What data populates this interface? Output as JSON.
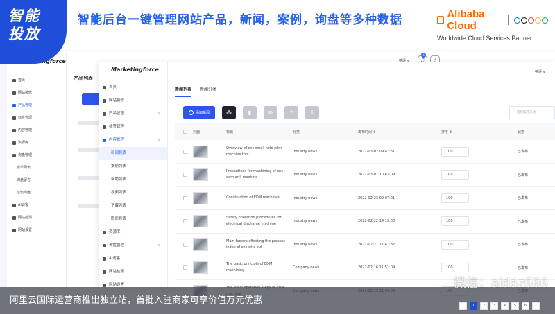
{
  "banner": {
    "badge_line1": "智能",
    "badge_line2": "投放",
    "headline": "智能后台一键管理网站产品，新闻，案例，询盘等多种数据",
    "partner_brand": "Alibaba Cloud",
    "partner_sub": "Worldwide Cloud Services Partner"
  },
  "back_app": {
    "logo": "Marketingforce",
    "title": "产品列表",
    "lang": "英语 ∨",
    "notification_count": "4",
    "menu": [
      {
        "label": "首页"
      },
      {
        "label": "网站装修"
      },
      {
        "label": "产品管理"
      },
      {
        "label": "标签管理"
      },
      {
        "label": "内容管理"
      },
      {
        "label": "资源库"
      },
      {
        "label": "询盘管理"
      },
      {
        "label": "表单列表"
      },
      {
        "label": "询盘留言"
      },
      {
        "label": "垃圾询盘"
      },
      {
        "label": "AI访客"
      },
      {
        "label": "网站检测"
      },
      {
        "label": "网站设置"
      }
    ]
  },
  "app": {
    "logo": "Marketingforce",
    "lang": "英语 ∨",
    "menu": [
      {
        "label": "首页"
      },
      {
        "label": "网站装修"
      },
      {
        "label": "产品管理"
      },
      {
        "label": "标签管理"
      },
      {
        "label": "内容管理"
      },
      {
        "label": "新闻列表"
      },
      {
        "label": "案例列表"
      },
      {
        "label": "帮助列表"
      },
      {
        "label": "视频列表"
      },
      {
        "label": "下载列表"
      },
      {
        "label": "图册列表"
      },
      {
        "label": "资源库"
      },
      {
        "label": "询盘管理"
      },
      {
        "label": "AI访客"
      },
      {
        "label": "网站检测"
      },
      {
        "label": "网站设置"
      }
    ],
    "tabs": [
      "新闻列表",
      "新闻分类"
    ],
    "add_button": "添加新闻",
    "filter_placeholder": "选择排序方式",
    "columns": [
      "封面",
      "标题",
      "分类",
      "发布时间 ⇕",
      "排序 ⇕",
      "状态"
    ],
    "rows": [
      {
        "title": "Overview of cnc small hole edm machine tool",
        "category": "Industry news",
        "date": "2022-03-02 09:47:31",
        "sort": "100",
        "status": "已发布"
      },
      {
        "title": "Precautions for machining of cnc edm drill machine",
        "category": "Industry news",
        "date": "2022-03-01 10:43:09",
        "sort": "100",
        "status": "已发布"
      },
      {
        "title": "Construction of EDM machines",
        "category": "Industry news",
        "date": "2022-02-23 09:07:01",
        "sort": "100",
        "status": "已发布"
      },
      {
        "title": "Safety operation procedures for electrical discharge machine",
        "category": "Industry news",
        "date": "2022-02-22 14:13:08",
        "sort": "100",
        "status": "已发布"
      },
      {
        "title": "Main factors affecting the process index of cnc wire cut",
        "category": "Industry news",
        "date": "2022-02-21 17:41:32",
        "sort": "100",
        "status": "已发布"
      },
      {
        "title": "The basic principle of EDM machining",
        "category": "Company news",
        "date": "2022-02-16 11:51:09",
        "sort": "100",
        "status": "已发布"
      },
      {
        "title": "The basic operation steps of EDM machine",
        "category": "Company news",
        "date": "2022-02-15 11:44:03",
        "sort": "100",
        "status": "已发布"
      }
    ],
    "pager": [
      "‹",
      "1",
      "2",
      "3",
      "4",
      "5",
      "6",
      "…"
    ]
  },
  "caption": "阿里云国际运营商推出独立站，首批入驻商家可享价值万元优惠",
  "watermark": "微信：aidaz666",
  "colors": {
    "primary": "#2f54eb",
    "headline": "#2563eb",
    "badge": "#1f4ed8",
    "alibaba": "#ff6a00"
  }
}
